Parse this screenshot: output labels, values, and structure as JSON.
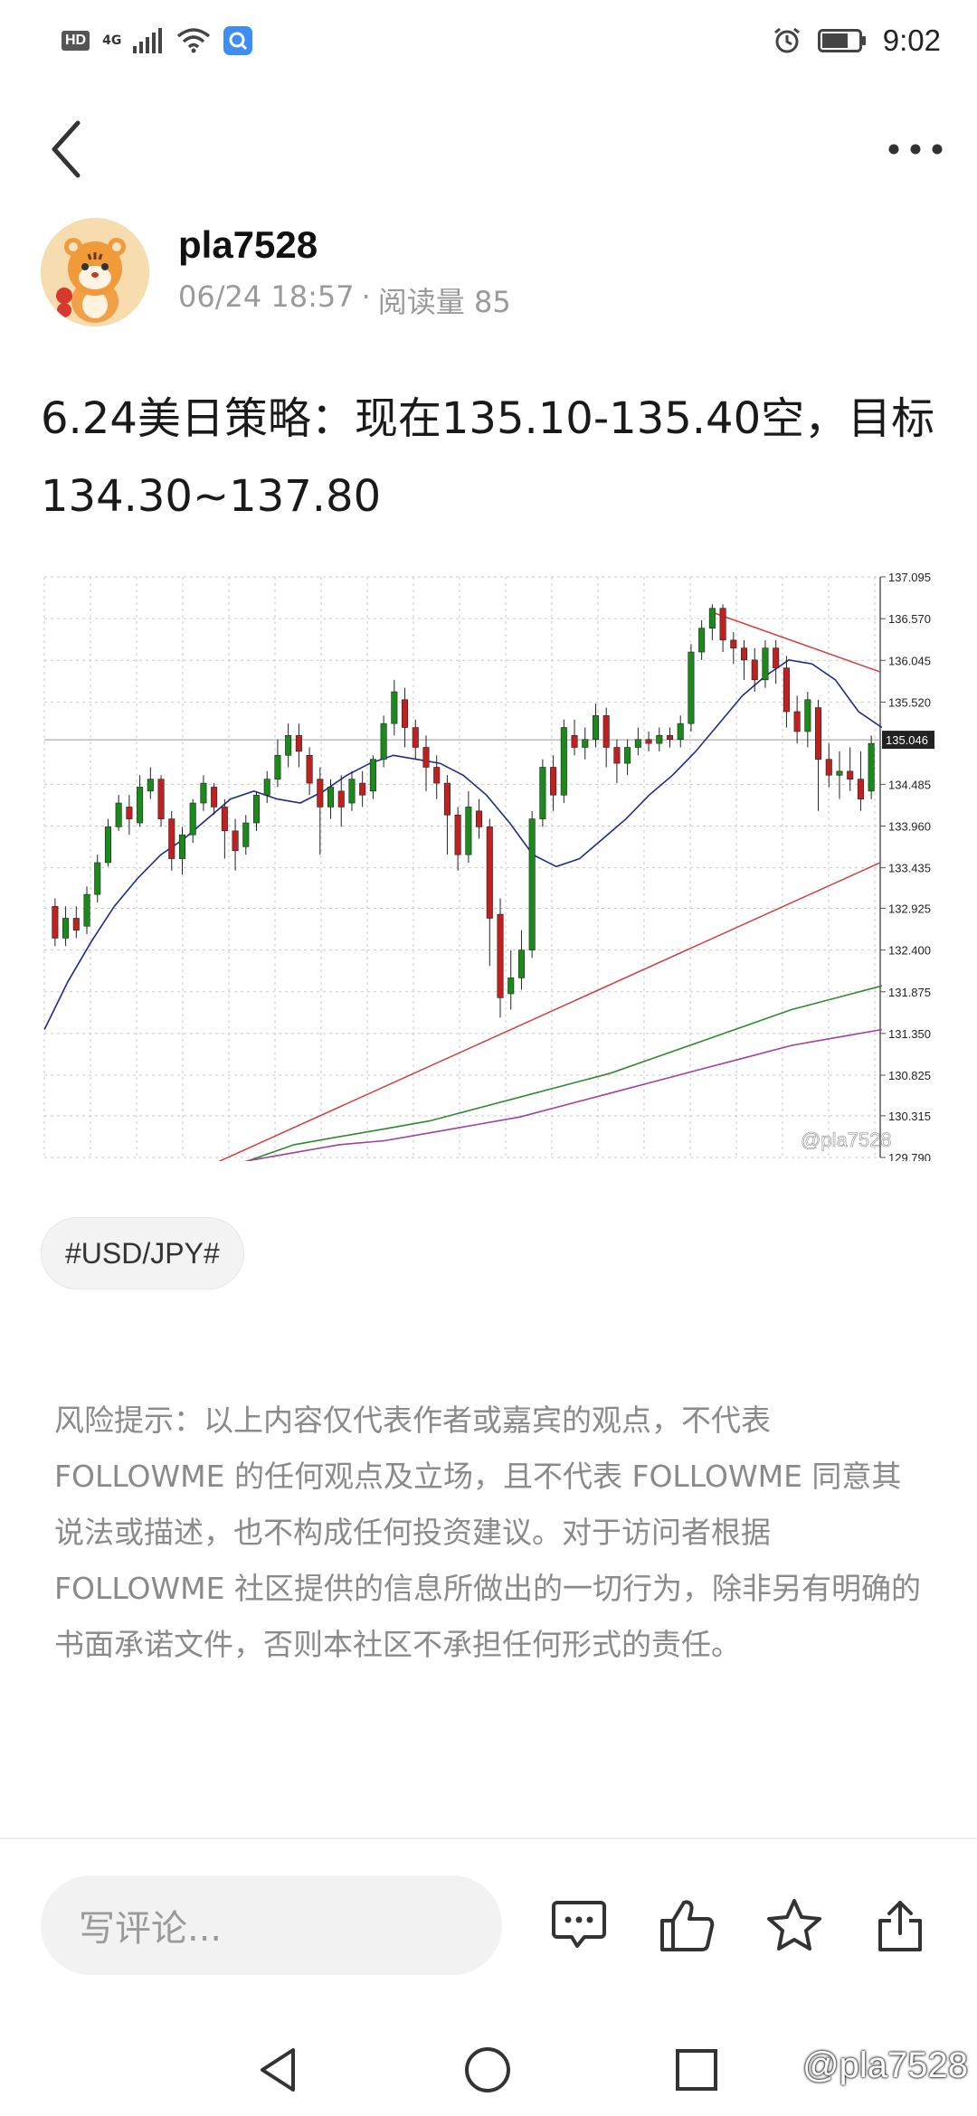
{
  "status_bar": {
    "hd": "HD",
    "network": "4G",
    "time": "9:02"
  },
  "author": {
    "name": "pla7528",
    "date": "06/24 18:57",
    "separator": "·",
    "reads": "阅读量 85"
  },
  "post": {
    "title": "6.24美日策略：现在135.10-135.40空，目标134.30~137.80"
  },
  "tag": "#USD/JPY#",
  "disclaimer": "风险提示：以上内容仅代表作者或嘉宾的观点，不代表 FOLLOWME 的任何观点及立场，且不代表 FOLLOWME 同意其说法或描述，也不构成任何投资建议。对于访问者根据 FOLLOWME 社区提供的信息所做出的一切行为，除非另有明确的书面承诺文件，否则本社区不承担任何形式的责任。",
  "comment": {
    "placeholder": "写评论..."
  },
  "actions": [
    "comment-icon",
    "like-icon",
    "favorite-icon",
    "share-icon"
  ],
  "watermark": "@pla7528",
  "colors": {
    "bull": "#1a8a1a",
    "bear": "#c0201f",
    "ma_fast": "#1f2a8c",
    "ma_green": "#2f8a2f",
    "ma_purple": "#a040a0",
    "trend": "#d04040"
  },
  "chart_data": {
    "type": "candlestick",
    "symbol": "USD/JPY",
    "current_price_label": "135.046",
    "y_ticks": [
      "137.095",
      "136.570",
      "136.045",
      "135.520",
      "134.485",
      "133.960",
      "133.435",
      "132.925",
      "132.400",
      "131.875",
      "131.350",
      "130.825",
      "130.315",
      "129.790"
    ],
    "ylim": [
      129.79,
      137.095
    ],
    "watermark": "@pla7528",
    "candles": [
      [
        132.95,
        132.55,
        133.05,
        132.45
      ],
      [
        132.55,
        132.8,
        132.95,
        132.45
      ],
      [
        132.8,
        132.65,
        132.95,
        132.55
      ],
      [
        132.7,
        133.1,
        133.2,
        132.6
      ],
      [
        133.1,
        133.5,
        133.6,
        133.0
      ],
      [
        133.5,
        133.95,
        134.05,
        133.45
      ],
      [
        133.95,
        134.25,
        134.35,
        133.9
      ],
      [
        134.2,
        134.05,
        134.35,
        133.85
      ],
      [
        134.0,
        134.45,
        134.6,
        133.95
      ],
      [
        134.4,
        134.55,
        134.7,
        134.3
      ],
      [
        134.55,
        134.05,
        134.6,
        133.95
      ],
      [
        134.05,
        133.55,
        134.15,
        133.4
      ],
      [
        133.55,
        133.85,
        133.95,
        133.35
      ],
      [
        133.85,
        134.25,
        134.3,
        133.75
      ],
      [
        134.25,
        134.5,
        134.6,
        134.15
      ],
      [
        134.45,
        134.2,
        134.5,
        134.1
      ],
      [
        134.2,
        133.9,
        134.3,
        133.55
      ],
      [
        133.9,
        133.65,
        134.05,
        133.4
      ],
      [
        133.7,
        134.0,
        134.1,
        133.6
      ],
      [
        134.0,
        134.35,
        134.4,
        133.9
      ],
      [
        134.35,
        134.55,
        134.65,
        134.25
      ],
      [
        134.55,
        134.85,
        135.05,
        134.45
      ],
      [
        134.85,
        135.1,
        135.25,
        134.7
      ],
      [
        135.1,
        134.9,
        135.25,
        134.7
      ],
      [
        134.85,
        134.5,
        134.95,
        134.35
      ],
      [
        134.55,
        134.2,
        134.7,
        133.6
      ],
      [
        134.2,
        134.45,
        134.55,
        134.05
      ],
      [
        134.4,
        134.2,
        134.6,
        133.95
      ],
      [
        134.25,
        134.55,
        134.65,
        134.15
      ],
      [
        134.5,
        134.35,
        134.65,
        134.2
      ],
      [
        134.4,
        134.8,
        134.85,
        134.3
      ],
      [
        134.8,
        135.25,
        135.35,
        134.7
      ],
      [
        135.25,
        135.65,
        135.8,
        135.1
      ],
      [
        135.55,
        135.2,
        135.7,
        134.95
      ],
      [
        135.2,
        134.95,
        135.3,
        134.8
      ],
      [
        134.95,
        134.7,
        135.1,
        134.4
      ],
      [
        134.7,
        134.5,
        134.85,
        134.3
      ],
      [
        134.5,
        134.1,
        134.6,
        133.6
      ],
      [
        134.1,
        133.6,
        134.2,
        133.4
      ],
      [
        133.6,
        134.2,
        134.4,
        133.5
      ],
      [
        134.15,
        133.95,
        134.3,
        133.8
      ],
      [
        133.95,
        132.8,
        134.05,
        132.2
      ],
      [
        132.85,
        131.8,
        133.05,
        131.55
      ],
      [
        131.85,
        132.05,
        132.4,
        131.65
      ],
      [
        132.05,
        132.4,
        132.65,
        131.9
      ],
      [
        132.4,
        134.05,
        134.15,
        132.3
      ],
      [
        134.05,
        134.7,
        134.8,
        133.95
      ],
      [
        134.7,
        134.35,
        134.85,
        134.15
      ],
      [
        134.35,
        135.2,
        135.3,
        134.25
      ],
      [
        135.1,
        134.95,
        135.3,
        134.85
      ],
      [
        134.95,
        135.05,
        135.2,
        134.8
      ],
      [
        135.05,
        135.35,
        135.5,
        134.95
      ],
      [
        135.35,
        134.95,
        135.45,
        134.7
      ],
      [
        134.95,
        134.75,
        135.05,
        134.5
      ],
      [
        134.75,
        134.95,
        135.05,
        134.6
      ],
      [
        134.95,
        135.05,
        135.2,
        134.85
      ],
      [
        135.05,
        135.0,
        135.15,
        134.9
      ],
      [
        135.0,
        135.1,
        135.2,
        134.9
      ],
      [
        135.1,
        135.05,
        135.2,
        134.95
      ],
      [
        135.05,
        135.25,
        135.35,
        134.95
      ],
      [
        135.25,
        136.15,
        136.25,
        135.15
      ],
      [
        136.15,
        136.45,
        136.55,
        136.05
      ],
      [
        136.45,
        136.7,
        136.75,
        136.3
      ],
      [
        136.7,
        136.3,
        136.75,
        136.15
      ],
      [
        136.3,
        136.2,
        136.4,
        136.0
      ],
      [
        136.2,
        136.05,
        136.3,
        135.8
      ],
      [
        136.05,
        135.8,
        136.2,
        135.65
      ],
      [
        135.8,
        136.2,
        136.3,
        135.7
      ],
      [
        136.2,
        135.95,
        136.3,
        135.75
      ],
      [
        135.95,
        135.4,
        136.1,
        135.2
      ],
      [
        135.4,
        135.15,
        135.6,
        135.0
      ],
      [
        135.15,
        135.55,
        135.65,
        134.95
      ],
      [
        135.45,
        134.8,
        135.55,
        134.15
      ],
      [
        134.8,
        134.6,
        135.0,
        134.45
      ],
      [
        134.6,
        134.65,
        134.9,
        134.3
      ],
      [
        134.65,
        134.55,
        134.95,
        134.4
      ],
      [
        134.55,
        134.3,
        134.9,
        134.15
      ],
      [
        134.4,
        135.0,
        135.1,
        134.3
      ]
    ],
    "ma_fast": [
      131.4,
      132.0,
      132.5,
      132.95,
      133.3,
      133.6,
      133.8,
      134.05,
      134.3,
      134.4,
      134.3,
      134.25,
      134.4,
      134.6,
      134.75,
      134.85,
      134.8,
      134.75,
      134.6,
      134.35,
      134.0,
      133.6,
      133.45,
      133.55,
      133.8,
      134.05,
      134.35,
      134.6,
      134.9,
      135.25,
      135.6,
      135.85,
      136.05,
      136.0,
      135.8,
      135.4,
      135.2
    ],
    "ma_green": [
      129.55,
      129.75,
      129.95,
      130.05,
      130.15,
      130.25,
      130.4,
      130.55,
      130.7,
      130.85,
      131.05,
      131.25,
      131.45,
      131.65,
      131.8,
      131.95
    ],
    "ma_purple": [
      129.6,
      129.75,
      129.85,
      129.95,
      130.0,
      130.1,
      130.2,
      130.3,
      130.45,
      130.6,
      130.75,
      130.9,
      131.05,
      131.2,
      131.3,
      131.4
    ],
    "trend_up": [
      [
        127.8,
        129.7
      ],
      [
        141.4,
        133.5
      ]
    ],
    "trend_down": [
      [
        136.62,
        136.65
      ],
      [
        137.2,
        135.9
      ]
    ]
  }
}
